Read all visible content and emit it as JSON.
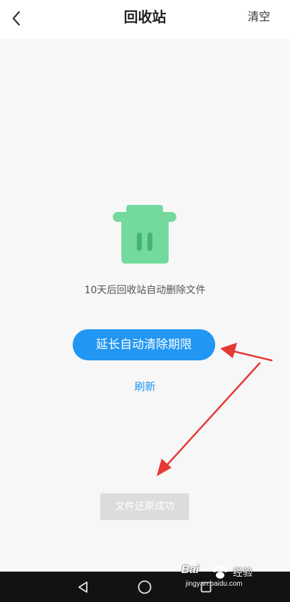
{
  "header": {
    "title": "回收站",
    "clear_label": "清空",
    "back_icon": "chevron-left-icon"
  },
  "main": {
    "icon": "trash-can-icon",
    "notice": "10天后回收站自动删除文件",
    "extend_button": "延长自动清除期限",
    "refresh_link": "刷新",
    "toast": "文件还原成功"
  },
  "navbar": {
    "back": "triangle-back-icon",
    "home": "circle-home-icon",
    "recents": "square-recents-icon"
  },
  "watermark": {
    "brand": "Bai",
    "label": "经验",
    "url": "jingyan.baidu.com"
  },
  "colors": {
    "accent": "#2196f3",
    "trash_icon": "#74d99c",
    "arrow": "#e53935",
    "background": "#f7f7f7"
  }
}
